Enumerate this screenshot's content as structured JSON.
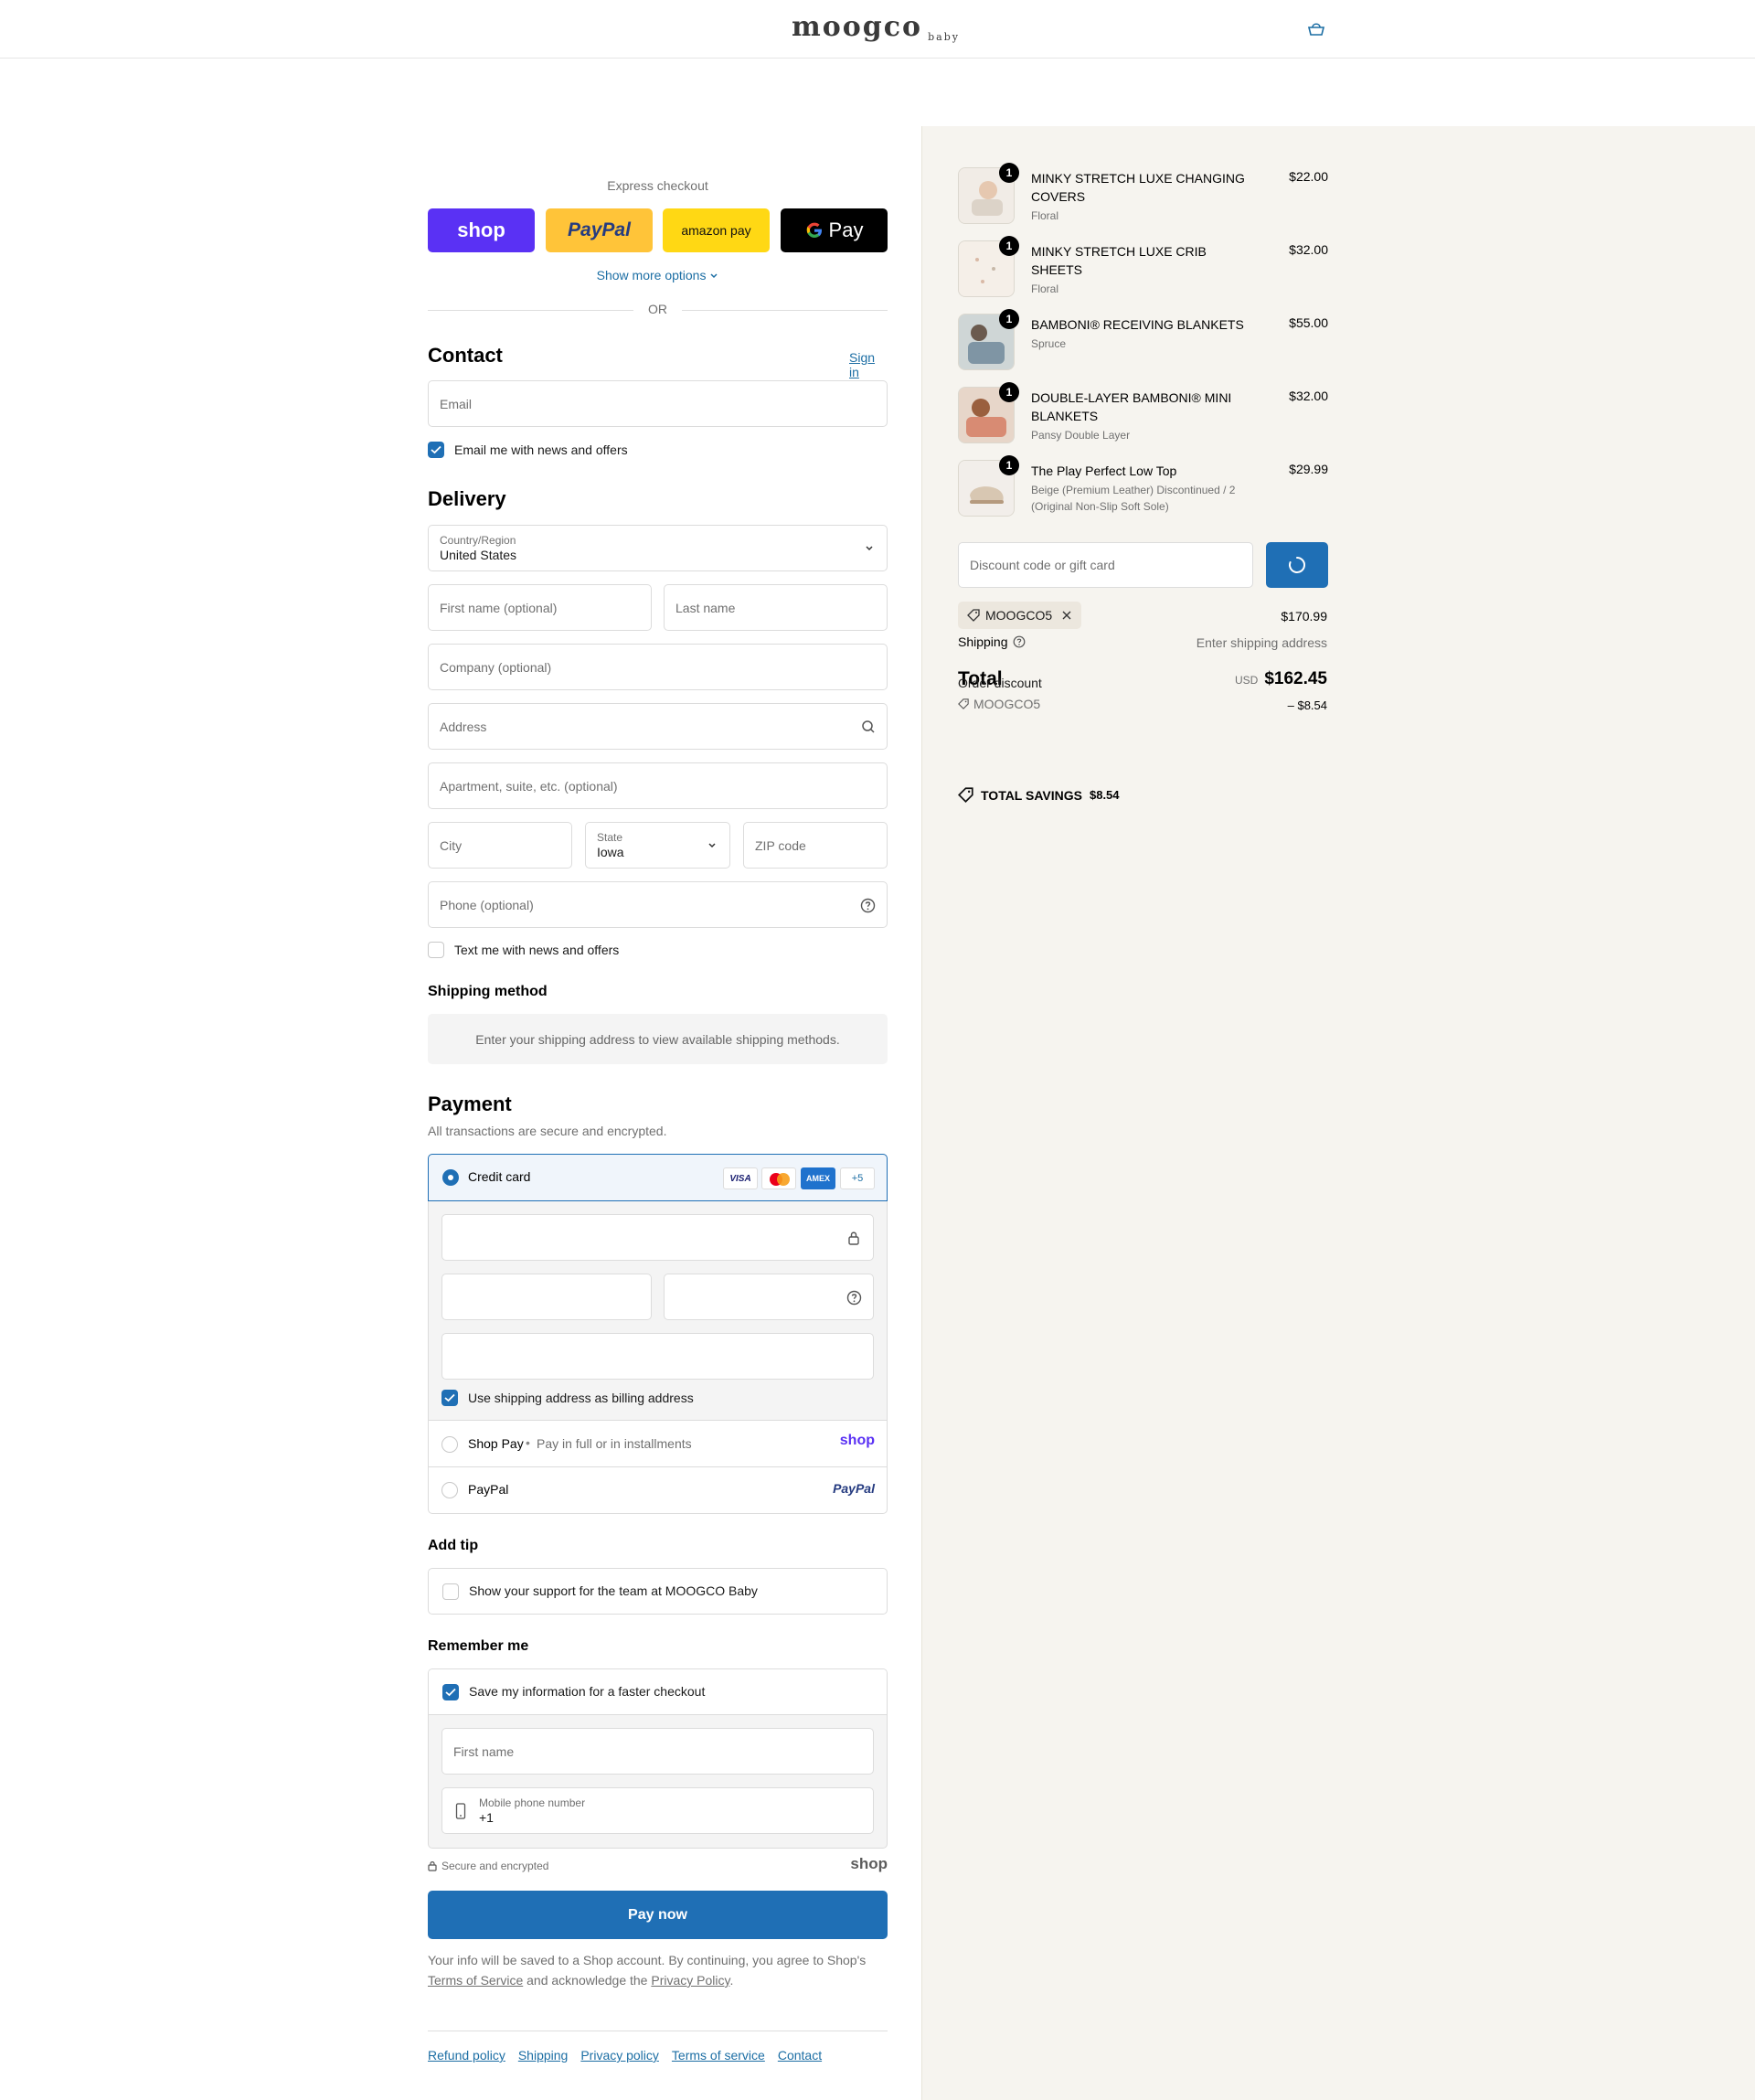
{
  "header": {
    "brand": "moogco",
    "brand_sub": "baby"
  },
  "express": {
    "title": "Express checkout",
    "shop_label": "shop",
    "paypal_label": "PayPal",
    "amazon_label": "amazon pay",
    "gpay_label": "Pay",
    "more_options": "Show more options",
    "or": "OR"
  },
  "contact": {
    "title": "Contact",
    "sign_in": "Sign in",
    "email_placeholder": "Email",
    "news_label": "Email me with news and offers"
  },
  "delivery": {
    "title": "Delivery",
    "country_label": "Country/Region",
    "country_value": "United States",
    "first_name": "First name (optional)",
    "last_name": "Last name",
    "company": "Company (optional)",
    "address": "Address",
    "apartment": "Apartment, suite, etc. (optional)",
    "city": "City",
    "state_label": "State",
    "state_value": "Iowa",
    "zip": "ZIP code",
    "phone": "Phone (optional)",
    "text_label": "Text me with news and offers"
  },
  "shipping_method": {
    "title": "Shipping method",
    "message": "Enter your shipping address to view available shipping methods."
  },
  "payment": {
    "title": "Payment",
    "subtitle": "All transactions are secure and encrypted.",
    "credit_card": "Credit card",
    "visa": "VISA",
    "amex": "AMEX",
    "more_cards": "+5",
    "billing_label": "Use shipping address as billing address",
    "shop_pay": "Shop Pay",
    "shop_pay_desc": "Pay in full or in installments",
    "shop_pay_logo": "shop",
    "paypal": "PayPal",
    "paypal_logo": "PayPal"
  },
  "tip": {
    "title": "Add tip",
    "label": "Show your support for the team at MOOGCO Baby"
  },
  "remember": {
    "title": "Remember me",
    "save_label": "Save my information for a faster checkout",
    "first_name": "First name",
    "mobile_label": "Mobile phone number",
    "mobile_value": "+1",
    "secure": "Secure and encrypted",
    "shop_logo": "shop"
  },
  "pay_now": "Pay now",
  "legal": {
    "text1": "Your info will be saved to a Shop account. By continuing, you agree to Shop's",
    "tos": "Terms of Service",
    "text2": "and acknowledge the",
    "privacy": "Privacy Policy",
    "text3": "."
  },
  "footer_links": [
    "Refund policy",
    "Shipping",
    "Privacy policy",
    "Terms of service",
    "Contact"
  ],
  "summary": {
    "items": [
      {
        "name": "MINKY STRETCH LUXE CHANGING COVERS",
        "variant": "Floral",
        "price": "$22.00",
        "qty": "1"
      },
      {
        "name": "MINKY STRETCH LUXE CRIB SHEETS",
        "variant": "Floral",
        "price": "$32.00",
        "qty": "1"
      },
      {
        "name": "BAMBONI® RECEIVING BLANKETS",
        "variant": "Spruce",
        "price": "$55.00",
        "qty": "1"
      },
      {
        "name": "DOUBLE-LAYER BAMBONI® MINI BLANKETS",
        "variant": "Pansy Double Layer",
        "price": "$32.00",
        "qty": "1"
      },
      {
        "name": "The Play Perfect Low Top",
        "variant": "Beige (Premium Leather) Discontinued / 2 (Original Non-Slip Soft Sole)",
        "price": "$29.99",
        "qty": "1"
      }
    ],
    "discount_placeholder": "Discount code or gift card",
    "code": "MOOGCO5",
    "subtotal": "$170.99",
    "shipping_label": "Shipping",
    "shipping_value": "Enter shipping address",
    "total_label": "Total",
    "order_discount_label": "Order discount",
    "currency": "USD",
    "total_value": "$162.45",
    "discount_code": "MOOGCO5",
    "discount_value": "– $8.54",
    "savings_label": "TOTAL SAVINGS",
    "savings_value": "$8.54"
  }
}
